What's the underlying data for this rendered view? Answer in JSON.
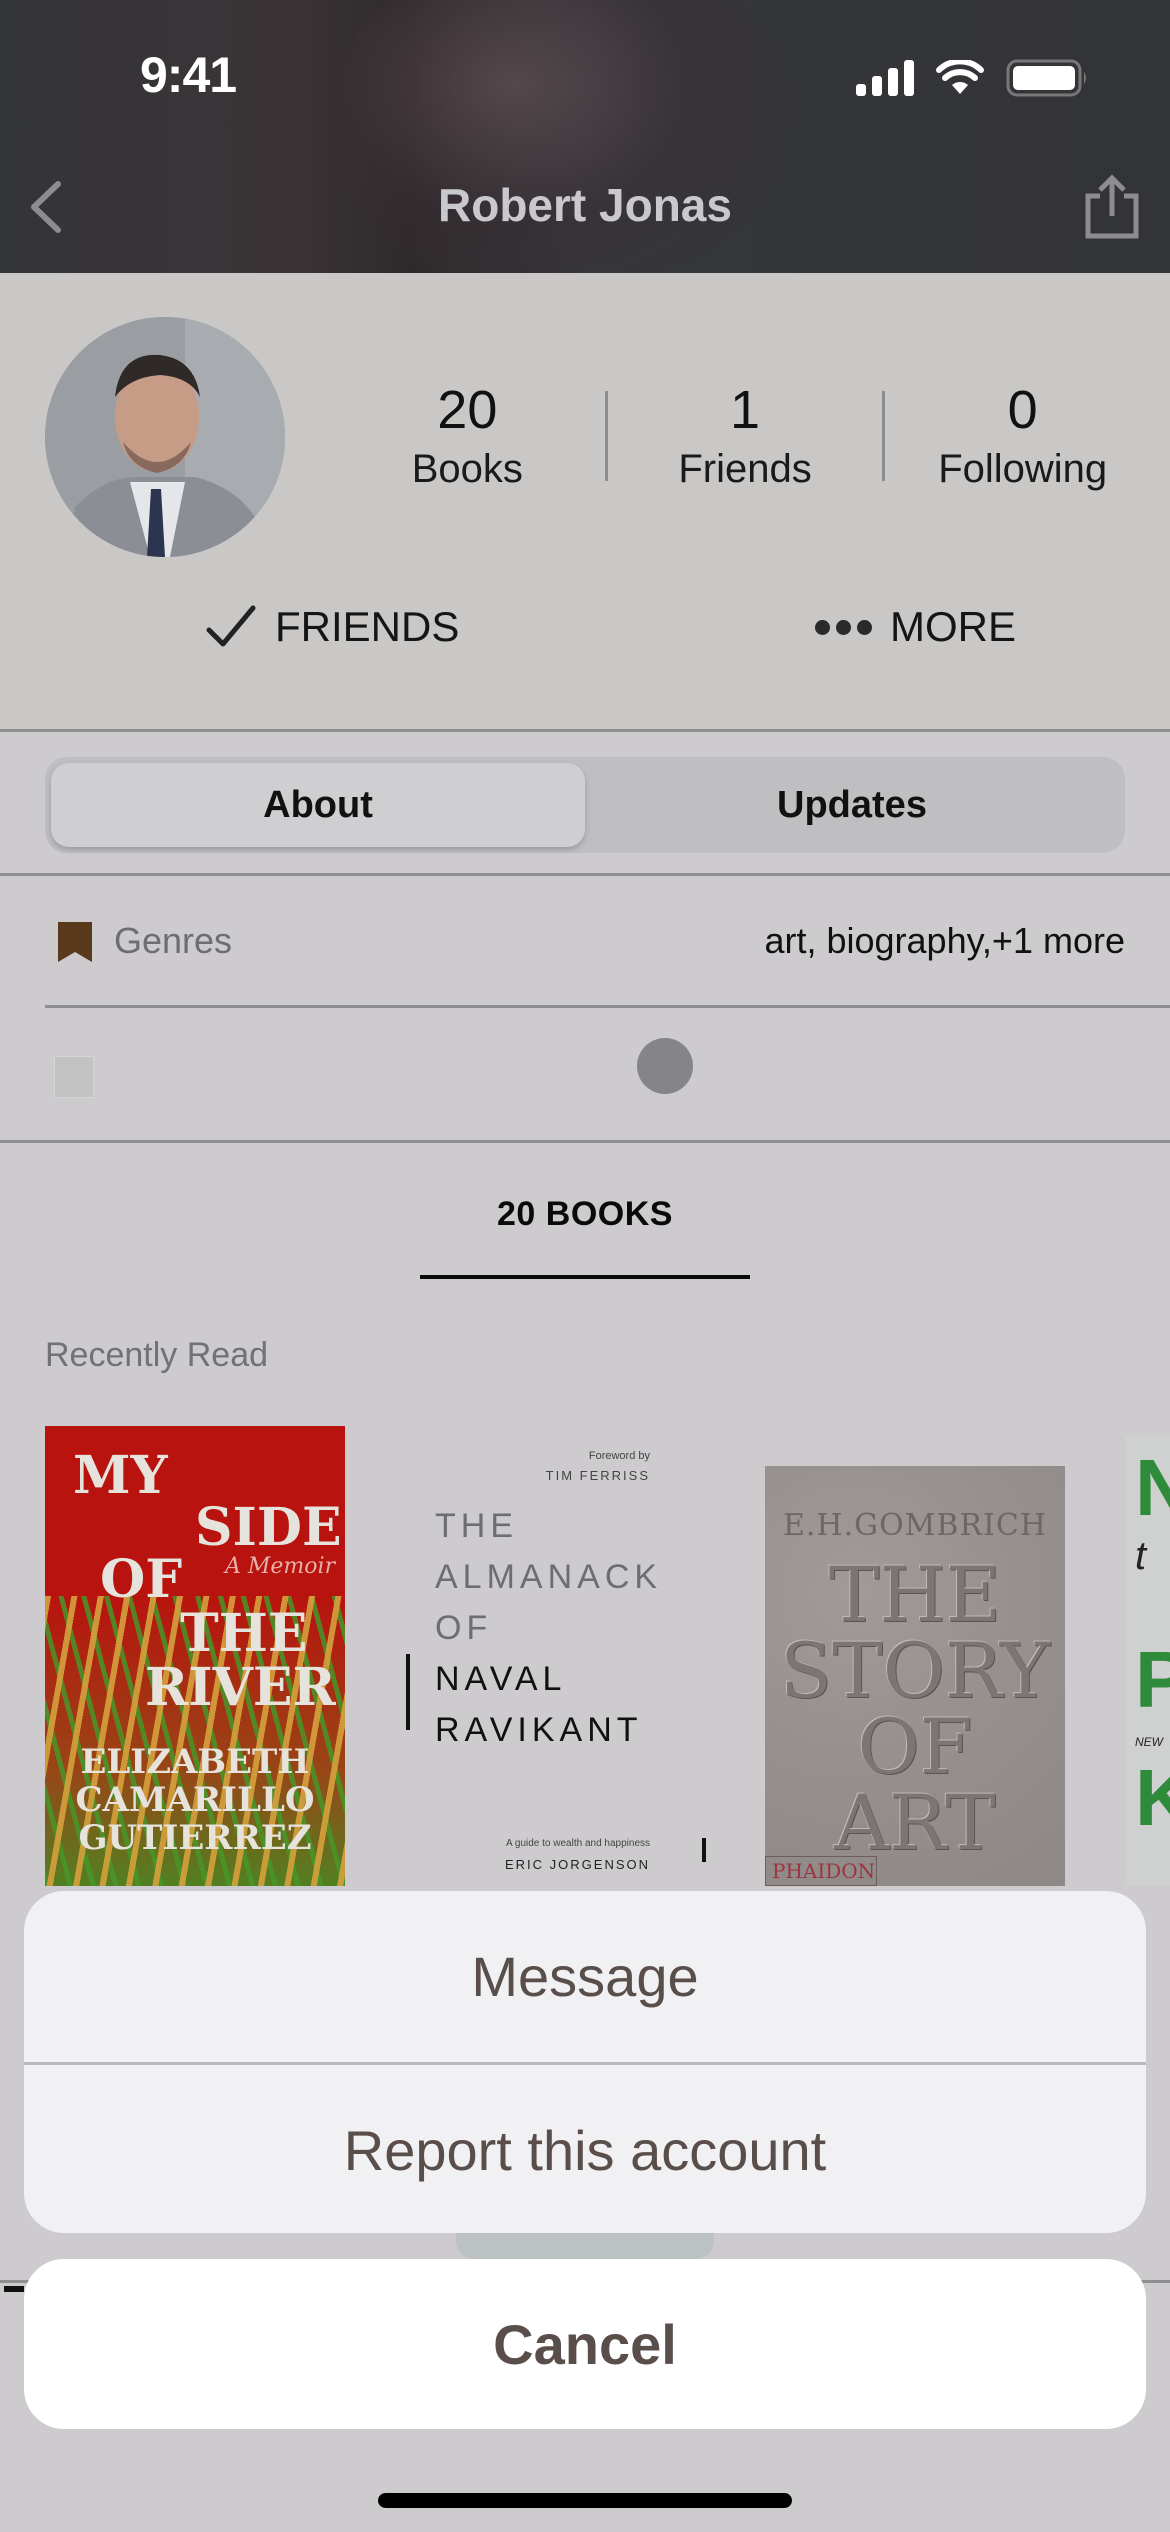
{
  "status_bar": {
    "time": "9:41",
    "icons": [
      "cellular-signal-icon",
      "wifi-icon",
      "battery-icon"
    ]
  },
  "nav": {
    "title": "Robert Jonas",
    "back_icon": "chevron-left-icon",
    "share_icon": "share-icon"
  },
  "profile": {
    "name": "Robert Jonas",
    "stats": [
      {
        "value": "20",
        "label": "Books"
      },
      {
        "value": "1",
        "label": "Friends"
      },
      {
        "value": "0",
        "label": "Following"
      }
    ],
    "actions": {
      "friends_label": "FRIENDS",
      "more_label": "MORE"
    }
  },
  "tabs": {
    "items": [
      {
        "label": "About",
        "active": true
      },
      {
        "label": "Updates",
        "active": false
      }
    ]
  },
  "about": {
    "genres_label": "Genres",
    "genres_value": "art, biography,+1 more"
  },
  "books": {
    "tab_label": "20 BOOKS",
    "section_label": "Recently Read",
    "items": [
      {
        "title_lines": [
          "MY",
          "SIDE",
          "OF",
          "THE",
          "RIVER"
        ],
        "subtitle": "A Memoir",
        "author_lines": [
          "ELIZABETH",
          "CAMARILLO",
          "GUTIERREZ"
        ],
        "cover_color": "#b8130e"
      },
      {
        "foreword_label": "Foreword by",
        "foreword_name": "TIM FERRISS",
        "title_lines": [
          "THE",
          "ALMANACK",
          "OF",
          "NAVAL",
          "RAVIKANT"
        ],
        "tagline": "A guide to wealth and happiness",
        "author": "ERIC JORGENSON",
        "cover_color": "#cdcbce"
      },
      {
        "author": "E.H.GOMBRICH",
        "title_lines": [
          "THE",
          "STORY",
          "OF",
          "ART"
        ],
        "publisher": "PHAIDON",
        "cover_color": "#958f8d"
      },
      {
        "visible_letters": [
          "N",
          "t",
          "P",
          "NEW",
          "K"
        ],
        "cover_color": "#cfd0d0"
      }
    ]
  },
  "action_sheet": {
    "items": [
      {
        "label": "Message"
      },
      {
        "label": "Report this account"
      }
    ],
    "cancel_label": "Cancel"
  },
  "colors": {
    "background": "#cdcbce",
    "header": "#333438",
    "sheet": "#f1f0f2",
    "sheet_text": "#5a4e4a",
    "genre_icon": "#5a3a1c"
  }
}
